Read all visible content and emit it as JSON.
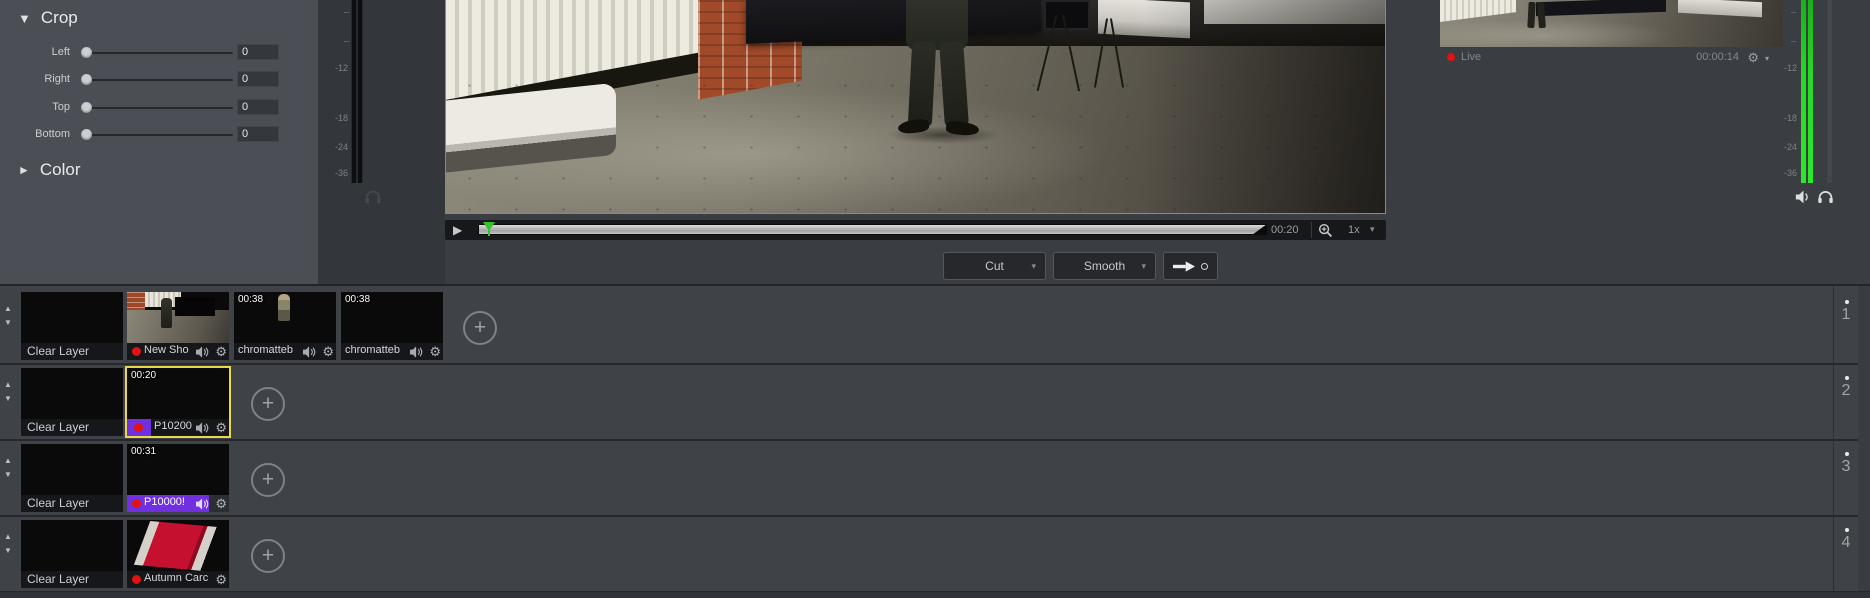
{
  "icons": {
    "collapse": "▼",
    "expand": "►",
    "play": "▶",
    "dropdown": "▾",
    "gear": "⚙",
    "row_up": "▲",
    "row_down": "▼",
    "add": "+"
  },
  "colors": {
    "accent_purple": "#7030e0",
    "selection_yellow": "#e8d94b",
    "record_red": "#e01212",
    "meter_green": "#2ce82c"
  },
  "crop_panel": {
    "title": "Crop",
    "sliders": [
      {
        "label": "Left",
        "value": "0"
      },
      {
        "label": "Right",
        "value": "0"
      },
      {
        "label": "Top",
        "value": "0"
      },
      {
        "label": "Bottom",
        "value": "0"
      }
    ],
    "color_section": {
      "title": "Color"
    }
  },
  "player": {
    "time": "00:20",
    "speed": "1x"
  },
  "transitions": {
    "cut_label": "Cut",
    "smooth_label": "Smooth"
  },
  "live_panel": {
    "status_label": "Live",
    "timecode": "00:00:14"
  },
  "meters": {
    "left": {
      "labels": [
        "-12",
        "-18",
        "-24",
        "-36"
      ]
    },
    "right": {
      "labels": [
        "-12",
        "-18",
        "-24",
        "-36"
      ]
    }
  },
  "timeline": {
    "rows": [
      {
        "number": "1",
        "clear_label": "Clear Layer",
        "clips": [
          {
            "title": "New Sho",
            "duration": ""
          },
          {
            "title": "chromatteb",
            "duration": "00:38"
          },
          {
            "title": "chromatteb",
            "duration": "00:38"
          }
        ]
      },
      {
        "number": "2",
        "clear_label": "Clear Layer",
        "clips": [
          {
            "title": "P10200",
            "duration": "00:20"
          }
        ]
      },
      {
        "number": "3",
        "clear_label": "Clear Layer",
        "clips": [
          {
            "title": "P10000!",
            "duration": "00:31"
          }
        ]
      },
      {
        "number": "4",
        "clear_label": "Clear Layer",
        "clips": [
          {
            "title": "Autumn Carc",
            "duration": ""
          }
        ]
      }
    ]
  }
}
